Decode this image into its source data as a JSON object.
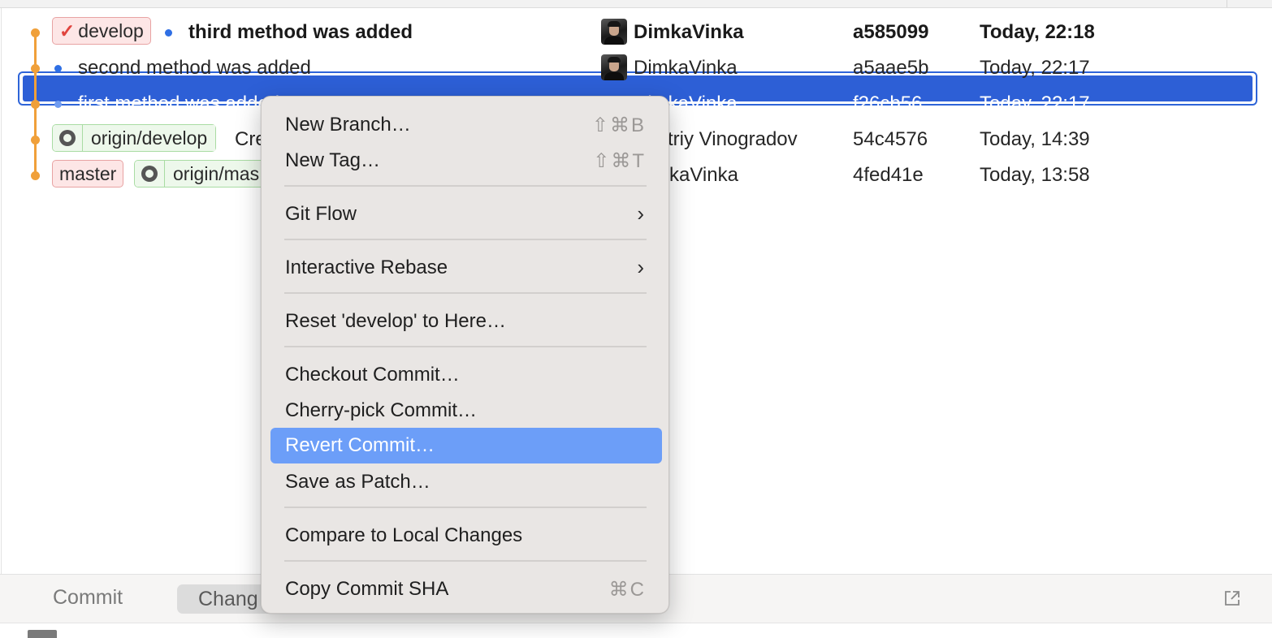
{
  "commits": [
    {
      "branches": [
        {
          "type": "local",
          "label": "develop",
          "checked": true
        }
      ],
      "subject": "third method was added",
      "author": "DimkaVinka",
      "sha": "a585099",
      "date": "Today, 22:18"
    },
    {
      "branches": [],
      "subject": "second method was added",
      "author": "DimkaVinka",
      "sha": "a5aae5b",
      "date": "Today, 22:17"
    },
    {
      "branches": [],
      "subject": "first method was added",
      "author": "DimkaVinka",
      "sha": "f26cb56",
      "date": "Today, 22:17"
    },
    {
      "branches": [
        {
          "type": "remote",
          "label": "origin/develop"
        }
      ],
      "subject": "Cre",
      "author": "triy Vinogradov",
      "sha": "54c4576",
      "date": "Today, 14:39"
    },
    {
      "branches": [
        {
          "type": "local",
          "label": "master"
        },
        {
          "type": "remote",
          "label": "origin/mas"
        }
      ],
      "subject": "",
      "author": "kaVinka",
      "sha": "4fed41e",
      "date": "Today, 13:58"
    }
  ],
  "context_menu": {
    "new_branch": {
      "label": "New Branch…",
      "shortcut": "⇧⌘B"
    },
    "new_tag": {
      "label": "New Tag…",
      "shortcut": "⇧⌘T"
    },
    "git_flow": {
      "label": "Git Flow"
    },
    "interactive_rebase": {
      "label": "Interactive Rebase"
    },
    "reset": {
      "label": "Reset 'develop' to Here…"
    },
    "checkout": {
      "label": "Checkout Commit…"
    },
    "cherry_pick": {
      "label": "Cherry-pick Commit…"
    },
    "revert": {
      "label": "Revert Commit…"
    },
    "save_patch": {
      "label": "Save as Patch…"
    },
    "compare": {
      "label": "Compare to Local Changes"
    },
    "copy_sha": {
      "label": "Copy Commit SHA",
      "shortcut": "⌘C"
    }
  },
  "bottom_tabs": {
    "commit": "Commit",
    "changes": "Chang"
  },
  "icons": {
    "submenu": "chevron-right-icon",
    "popout": "open-external-icon",
    "remote": "github-icon",
    "current_branch": "checkmark-icon"
  },
  "colors": {
    "graph": "#f0a03a",
    "selection": "#2d5fd6",
    "menu_highlight": "#6c9ef8",
    "local_branch_bg": "#fde6e6",
    "remote_branch_border": "#a9dca3"
  }
}
